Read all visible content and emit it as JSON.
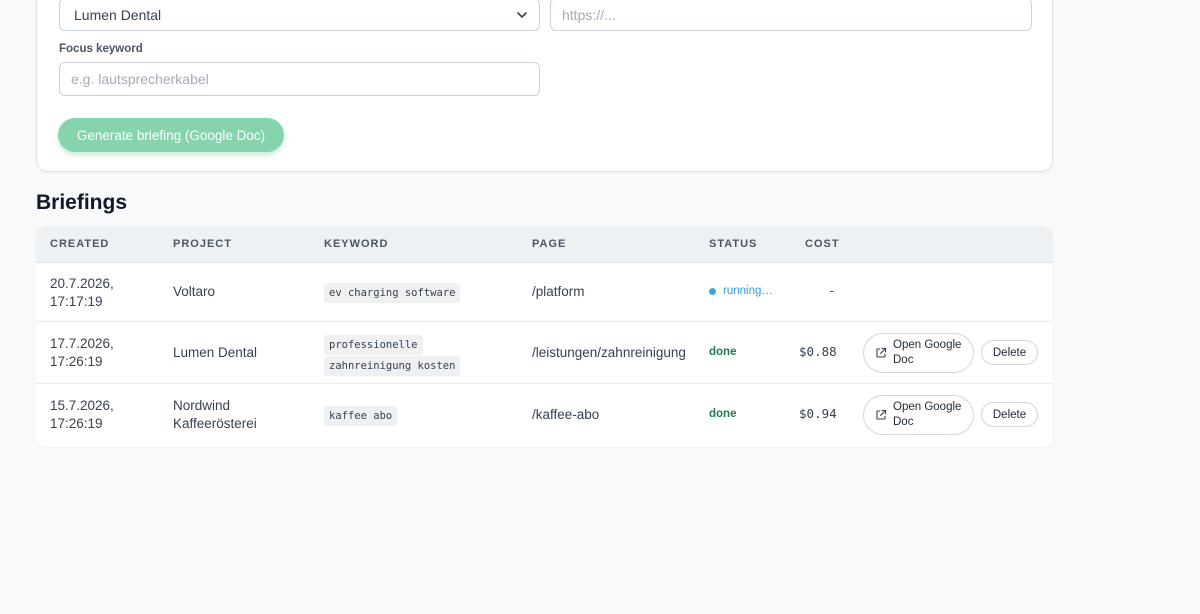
{
  "form": {
    "project_select_value": "Lumen Dental",
    "url_placeholder": "https://...",
    "focus_keyword_label": "Focus keyword",
    "focus_keyword_placeholder": "e.g. lautsprecherkabel",
    "generate_button_label": "Generate briefing (Google Doc)",
    "accent_color": "#86d4ad"
  },
  "briefings": {
    "title": "Briefings",
    "columns": [
      "CREATED",
      "PROJECT",
      "KEYWORD",
      "PAGE",
      "STATUS",
      "COST"
    ],
    "rows": [
      {
        "created_date": "20.7.2026,",
        "created_time": "17:17:19",
        "project": "Voltaro",
        "keyword_lines": [
          "ev charging software"
        ],
        "page": "/platform",
        "status": "running…",
        "cost": "-"
      },
      {
        "created_date": "17.7.2026,",
        "created_time": "17:26:19",
        "project": "Lumen Dental",
        "keyword_lines": [
          "professionelle",
          "zahnreinigung kosten"
        ],
        "page": "/leistungen/zahnreinigung",
        "status": "done",
        "cost": "$0.88",
        "open_label_1": "Open Google",
        "open_label_2": "Doc",
        "delete_label": "Delete"
      },
      {
        "created_date": "15.7.2026,",
        "created_time": "17:26:19",
        "project_line_1": "Nordwind",
        "project_line_2": "Kaffeerösterei",
        "keyword_lines": [
          "kaffee abo"
        ],
        "page": "/kaffee-abo",
        "status": "done",
        "cost": "$0.94",
        "open_label_1": "Open Google",
        "open_label_2": "Doc",
        "delete_label": "Delete"
      }
    ],
    "status_colors": {
      "done": "#1f7a4f",
      "running": "#2f9bd6"
    }
  }
}
